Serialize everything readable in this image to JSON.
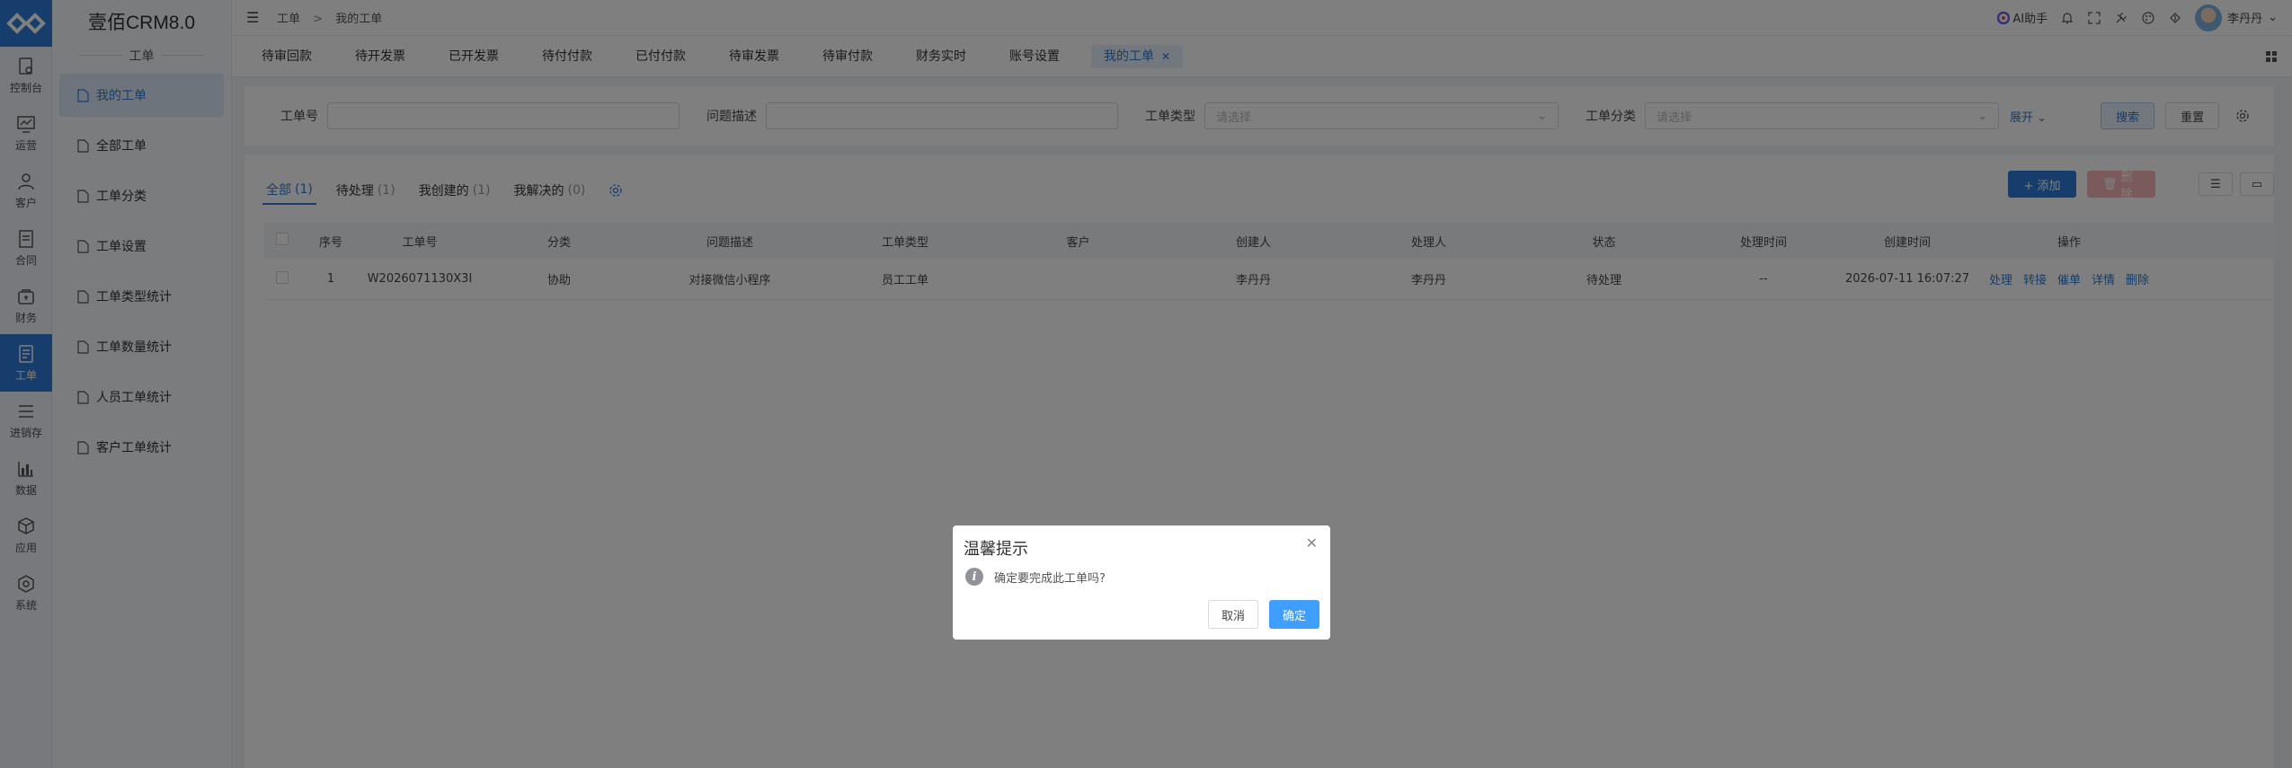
{
  "rail": {
    "items": [
      {
        "label": "控制台",
        "icon": "dashboard-icon"
      },
      {
        "label": "运营",
        "icon": "chart-monitor-icon"
      },
      {
        "label": "客户",
        "icon": "customer-icon"
      },
      {
        "label": "合同",
        "icon": "contract-icon"
      },
      {
        "label": "财务",
        "icon": "finance-icon"
      },
      {
        "label": "工单",
        "icon": "ticket-icon"
      },
      {
        "label": "进销存",
        "icon": "list-icon"
      },
      {
        "label": "数据",
        "icon": "bar-chart-icon"
      },
      {
        "label": "应用",
        "icon": "cube-icon"
      },
      {
        "label": "系统",
        "icon": "hexagon-icon"
      }
    ]
  },
  "submenu": {
    "brand": "壹佰CRM8.0",
    "module": "工单",
    "items": [
      {
        "label": "我的工单"
      },
      {
        "label": "全部工单"
      },
      {
        "label": "工单分类"
      },
      {
        "label": "工单设置"
      },
      {
        "label": "工单类型统计"
      },
      {
        "label": "工单数量统计"
      },
      {
        "label": "人员工单统计"
      },
      {
        "label": "客户工单统计"
      }
    ]
  },
  "topbar": {
    "breadcrumb_1": "工单",
    "breadcrumb_sep": ">",
    "breadcrumb_2": "我的工单",
    "ai_label": "AI助手",
    "user_name": "李丹丹"
  },
  "tabs": [
    {
      "label": "待审回款"
    },
    {
      "label": "待开发票"
    },
    {
      "label": "已开发票"
    },
    {
      "label": "待付付款"
    },
    {
      "label": "已付付款"
    },
    {
      "label": "待审发票"
    },
    {
      "label": "待审付款"
    },
    {
      "label": "财务实时"
    },
    {
      "label": "账号设置"
    },
    {
      "label": "我的工单"
    }
  ],
  "filters": {
    "ticket_no_label": "工单号",
    "ticket_no_value": "",
    "problem_label": "问题描述",
    "problem_value": "",
    "type_label": "工单类型",
    "type_placeholder": "请选择",
    "category_label": "工单分类",
    "category_placeholder": "请选择",
    "expand_label": "展开",
    "search_button": "搜索",
    "reset_button": "重置"
  },
  "subtabs": [
    {
      "label": "全部",
      "count": "(1)"
    },
    {
      "label": "待处理",
      "count": "(1)"
    },
    {
      "label": "我创建的",
      "count": "(1)"
    },
    {
      "label": "我解决的",
      "count": "(0)"
    }
  ],
  "actions": {
    "add_button": "+ 添加",
    "delete_button": "删除"
  },
  "table": {
    "headers": [
      "序号",
      "工单号",
      "分类",
      "问题描述",
      "工单类型",
      "客户",
      "创建人",
      "处理人",
      "状态",
      "处理时间",
      "创建时间",
      "操作"
    ],
    "rows": [
      {
        "index": "1",
        "ticket_no": "W2026071130X3I",
        "category": "协助",
        "problem": "对接微信小程序",
        "type": "员工工单",
        "customer": "",
        "creator": "李丹丹",
        "handler": "李丹丹",
        "status": "待处理",
        "handle_time": "--",
        "create_time": "2026-07-11 16:07:27",
        "ops": [
          "处理",
          "转接",
          "催单",
          "详情",
          "删除"
        ]
      }
    ]
  },
  "modal": {
    "title": "温馨提示",
    "message": "确定要完成此工单吗?",
    "cancel": "取消",
    "confirm": "确定"
  },
  "colors": {
    "primary": "#2d7bd6",
    "danger_disabled": "#f5b4b4",
    "overlay": "rgba(0,0,0,0.5)"
  }
}
